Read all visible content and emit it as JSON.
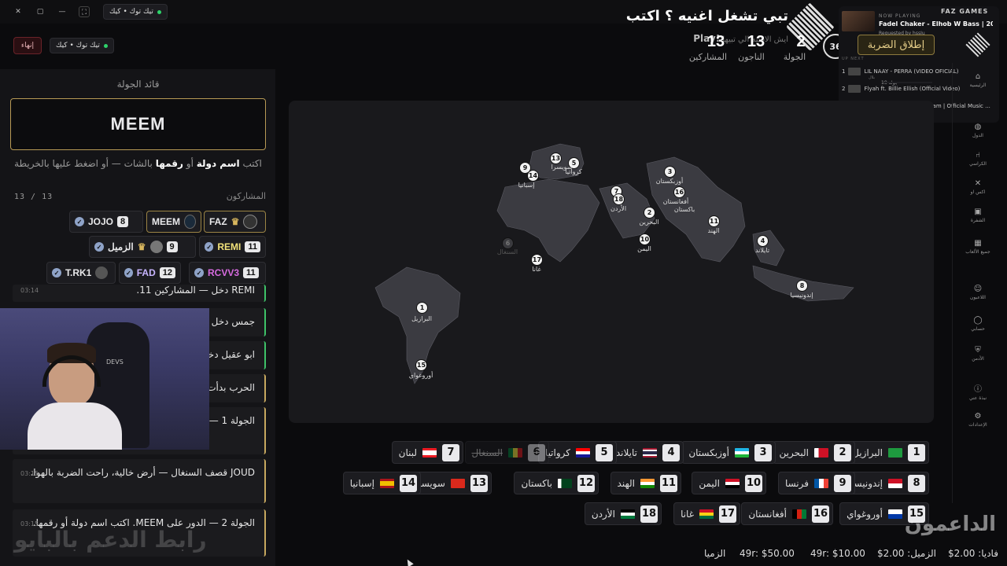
{
  "top_chips": {
    "window_tab": "تيك توك • كيك",
    "left_tab": "تيك توك • كيك",
    "end_button": "إنهاء"
  },
  "header": {
    "title": "تبي تشغل اغنيه ؟ اكتب",
    "subtitle": "ايش الاغنيه الي تبيها",
    "command": "!Play",
    "timer": "36",
    "stats": [
      {
        "value": "2",
        "label": "الجولة"
      },
      {
        "value": "13",
        "label": "الناجون"
      },
      {
        "value": "13",
        "label": "المشاركين"
      }
    ]
  },
  "now_playing": {
    "label": "NOW PLAYING",
    "track": "Fadel Chaker - Elhob W Bass | 20...",
    "requested": "Requested by hssJu",
    "brand": "FAZ GAMES",
    "fire_button": "إطلاق الضربة",
    "up_next": "UP NEXT",
    "queue": [
      {
        "n": "1",
        "title": "LIL NAAY - PERRA (VIDEO OFICIAL)",
        "by": "بلال"
      },
      {
        "n": "2",
        "title": "Flyah ft. Billie Ellish (Official Video)",
        "by": "جولة 18"
      },
      {
        "n": "3",
        "title": "Oumaima Taleb - Aisaa Kam | Official Music ...",
        "by": ""
      }
    ]
  },
  "left": {
    "leader_label": "قائد الجولة",
    "leader_name": "MEEM",
    "hint_pre": "اكتب ",
    "hint_b1": "اسم دولة",
    "hint_mid": " أو ",
    "hint_b2": "رقمها",
    "hint_post": " بالشات — أو اضغط عليها بالخريطة",
    "participants_label": "المشاركون",
    "participants_count": "13 / 13",
    "players": [
      {
        "name": "FAZ",
        "num": "",
        "crown": "♛"
      },
      {
        "name": "MEEM",
        "num": "",
        "crown": ""
      },
      {
        "name": "JOJO",
        "num": "8",
        "crown": ""
      },
      {
        "name": "REMI",
        "num": "11",
        "crown": ""
      },
      {
        "name": "الزميل",
        "num": "9",
        "crown": "♛"
      },
      {
        "name": "RCVV3",
        "num": "11",
        "crown": ""
      },
      {
        "name": "FAD",
        "num": "12",
        "crown": ""
      },
      {
        "name": "T.RK1",
        "num": "",
        "crown": ""
      }
    ],
    "chat": [
      {
        "text": "REMI دخل — المشاركين 11.",
        "time": "03:14"
      },
      {
        "text": "جمس دخل",
        "time": ""
      },
      {
        "text": "ابو عقيل دخل",
        "time": ""
      },
      {
        "text": "الحرب بدأت",
        "time": ""
      },
      {
        "text": "الجولة 1 — الدور على ... اكتب اسم دولة أو رقمها.",
        "time": ""
      },
      {
        "text": "JOUD قصف السنغال — أرض خالية، راحت الضربة بالهوا.",
        "time": "03:15"
      },
      {
        "text": "الجولة 2 — الدور على MEEM. اكتب اسم دولة أو رقمها.",
        "time": "03:15"
      }
    ],
    "watermark": "رابط الدعم بالبايو",
    "cam_logo": "DEVS"
  },
  "map_pins": [
    {
      "n": "1",
      "label": "البرازيل"
    },
    {
      "n": "2",
      "label": "البحرين"
    },
    {
      "n": "3",
      "label": "أوزبكستان"
    },
    {
      "n": "4",
      "label": "تايلاند"
    },
    {
      "n": "5",
      "label": "كرواتيا"
    },
    {
      "n": "6",
      "label": "السنغال"
    },
    {
      "n": "7",
      "label": ""
    },
    {
      "n": "8",
      "label": "إندونيسيا"
    },
    {
      "n": "9",
      "label": ""
    },
    {
      "n": "10",
      "label": "اليمن"
    },
    {
      "n": "11",
      "label": "الهند"
    },
    {
      "n": "13",
      "label": "سويسرا"
    },
    {
      "n": "14",
      "label": "إسبانيا"
    },
    {
      "n": "15",
      "label": "أوروغواي"
    },
    {
      "n": "16",
      "label": "أفغانستان"
    },
    {
      "n": "17",
      "label": "غانا"
    },
    {
      "n": "18",
      "label": "الأردن"
    },
    {
      "n": "",
      "label": "باكستان"
    }
  ],
  "countries": [
    {
      "n": "1",
      "name": "البرازيل",
      "flag": "br"
    },
    {
      "n": "2",
      "name": "البحرين",
      "flag": "bh"
    },
    {
      "n": "3",
      "name": "أوزبكستان",
      "flag": "uz"
    },
    {
      "n": "4",
      "name": "تايلاند",
      "flag": "th"
    },
    {
      "n": "5",
      "name": "كرواتيا",
      "flag": "hr"
    },
    {
      "n": "6",
      "name": "السنغال",
      "flag": "sn",
      "eliminated": true
    },
    {
      "n": "7",
      "name": "لبنان",
      "flag": "lb"
    },
    {
      "n": "8",
      "name": "إندونيسيا",
      "flag": "id"
    },
    {
      "n": "9",
      "name": "فرنسا",
      "flag": "fr"
    },
    {
      "n": "10",
      "name": "اليمن",
      "flag": "ye"
    },
    {
      "n": "11",
      "name": "الهند",
      "flag": "in"
    },
    {
      "n": "12",
      "name": "باكستان",
      "flag": "pk"
    },
    {
      "n": "13",
      "name": "سويسرا",
      "flag": "ch"
    },
    {
      "n": "14",
      "name": "إسبانيا",
      "flag": "es"
    },
    {
      "n": "15",
      "name": "أوروغواي",
      "flag": "uy"
    },
    {
      "n": "16",
      "name": "أفغانستان",
      "flag": "af"
    },
    {
      "n": "17",
      "name": "غانا",
      "flag": "gh"
    },
    {
      "n": "18",
      "name": "الأردن",
      "flag": "jo"
    }
  ],
  "sidebar": [
    {
      "label": "الرئيسية",
      "icon": "home-icon"
    },
    {
      "label": "الدول",
      "icon": "globe-icon"
    },
    {
      "label": "الكراسي",
      "icon": "chair-icon"
    },
    {
      "label": "اكس او",
      "icon": "xo-icon"
    },
    {
      "label": "الشفرة",
      "icon": "lock-icon"
    },
    {
      "label": "جميع الألعاب",
      "icon": "grid-icon"
    },
    {
      "label": "اللاعبون",
      "icon": "users-icon"
    },
    {
      "label": "حسابي",
      "icon": "user-icon"
    },
    {
      "label": "الأدمن",
      "icon": "shield-icon"
    },
    {
      "label": "نبذة عني",
      "icon": "info-icon"
    },
    {
      "label": "الإعدادات",
      "icon": "gear-icon"
    }
  ],
  "supporters_title": "الداعمون",
  "bottom_bar": [
    "فاديا: 2.00$",
    "الزميل: 2.00$",
    "49r: $10.00",
    "49r: $50.00",
    "الزميا"
  ],
  "colors": {
    "gold": "#c7a85f",
    "green": "#3ec268",
    "bg": "#0b0b0d",
    "map_land": "#3b3b41"
  }
}
